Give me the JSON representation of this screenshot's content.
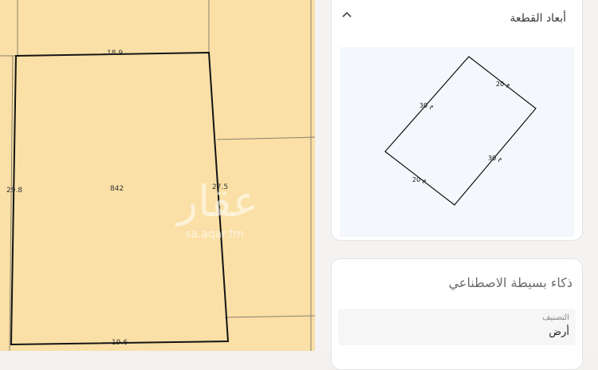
{
  "map": {
    "main_plot_area": "842",
    "top_side": "18.9",
    "bottom_side": "19.6",
    "left_side": "29.8",
    "right_side": "27.5",
    "watermark_arabic": "عقار",
    "watermark_url": "sa.aqar.fm",
    "colors": {
      "plot_fill": "#fae0a6",
      "boundary": "#141414",
      "parcel_lines": "#8a8070"
    }
  },
  "dimensions_card": {
    "title": "أبعاد القطعة",
    "chevron": "chevron-up-icon",
    "labels": {
      "top_right": "20 م",
      "top_left": "30 م",
      "bottom_right": "30 م",
      "bottom_left": "20 م"
    }
  },
  "ai_card": {
    "title": "ذكاء بسيطة الاصطناعي",
    "classification_label": "التصنيف",
    "classification_value": "أرض"
  }
}
